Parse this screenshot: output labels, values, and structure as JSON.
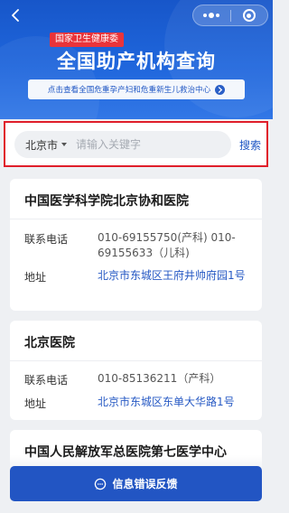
{
  "header": {
    "badge": "国家卫生健康委",
    "title": "全国助产机构查询",
    "banner_text": "点击查看全国危重孕产妇和危重新生儿救治中心"
  },
  "search": {
    "city": "北京市",
    "placeholder": "请输入关键字",
    "button_label": "搜索"
  },
  "labels": {
    "phone": "联系电话",
    "address": "地址"
  },
  "results": [
    {
      "name": "中国医学科学院北京协和医院",
      "phone": "010-69155750(产科) 010-69155633（儿科)",
      "address": "北京市东城区王府井帅府园1号"
    },
    {
      "name": "北京医院",
      "phone": "010-85136211（产科）",
      "address": "北京市东城区东单大华路1号"
    },
    {
      "name": "中国人民解放军总医院第七医学中心"
    }
  ],
  "footer": {
    "feedback_label": "信息错误反馈"
  },
  "colors": {
    "header_blue": "#1f66dc",
    "badge_red": "#e9343a",
    "link_blue": "#2659c4",
    "button_blue": "#2255c3",
    "highlight_red": "#e01e2a"
  }
}
